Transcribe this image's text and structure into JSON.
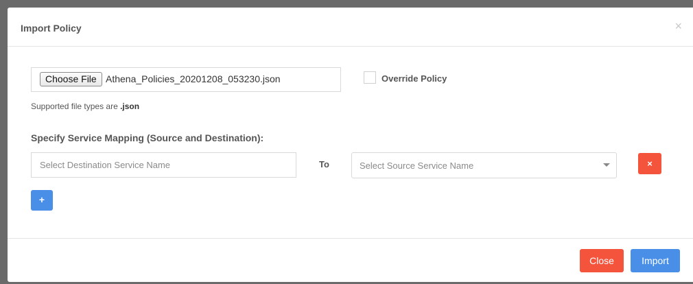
{
  "modal": {
    "title": "Import Policy",
    "close_glyph": "×"
  },
  "file_input": {
    "button_label": "Choose File",
    "file_name": "Athena_Policies_20201208_053230.json"
  },
  "override": {
    "label": "Override Policy",
    "checked": false
  },
  "supported": {
    "prefix": "Supported file types are ",
    "types": ".json"
  },
  "mapping": {
    "title": "Specify Service Mapping (Source and Destination):",
    "destination_placeholder": "Select Destination Service Name",
    "destination_value": "",
    "to_label": "To",
    "source_placeholder": "Select Source Service Name",
    "remove_glyph": "×",
    "add_glyph": "+"
  },
  "footer": {
    "close_label": "Close",
    "import_label": "Import"
  },
  "colors": {
    "danger": "#f4533c",
    "primary": "#4a8fe7"
  }
}
